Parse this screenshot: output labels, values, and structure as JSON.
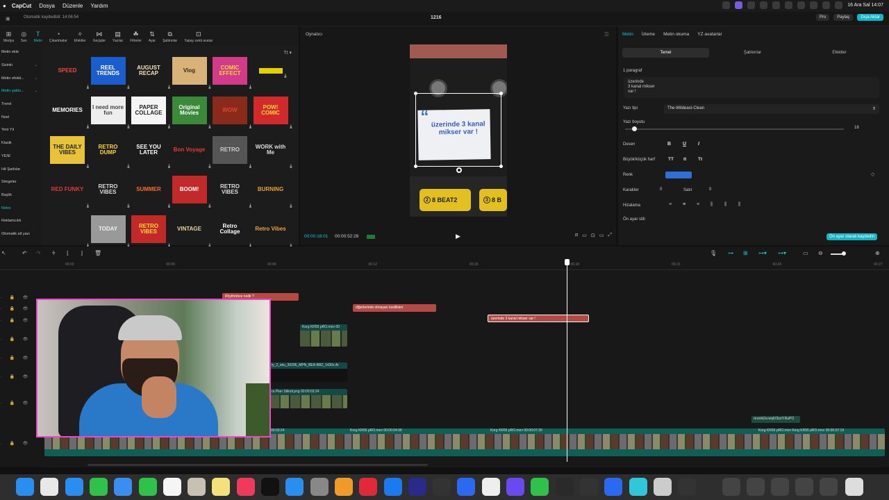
{
  "menubar": {
    "app": "CapCut",
    "items": [
      "Dosya",
      "Düzenle",
      "Yardım"
    ],
    "datetime": "16 Ara Sal  14:07"
  },
  "titlebar": {
    "autosave": "Otomatik kaydedildi: 14:06:54",
    "project": "1216",
    "pro": "Pro",
    "share": "Paylaş",
    "export": "Dışa Aktar"
  },
  "toolbar": [
    {
      "label": "Medya",
      "icon": "media-icon"
    },
    {
      "label": "Ses",
      "icon": "audio-icon"
    },
    {
      "label": "Metin",
      "icon": "text-icon",
      "active": true
    },
    {
      "label": "Çıkartmalar",
      "icon": "sticker-icon"
    },
    {
      "label": "Efektler",
      "icon": "effects-icon"
    },
    {
      "label": "Geçişler",
      "icon": "transitions-icon"
    },
    {
      "label": "Yazılar",
      "icon": "captions-icon"
    },
    {
      "label": "Filtreler",
      "icon": "filters-icon"
    },
    {
      "label": "Ayar",
      "icon": "adjust-icon"
    },
    {
      "label": "Şablonlar",
      "icon": "templates-icon"
    },
    {
      "label": "Yapay zekâ avatar",
      "icon": "ai-avatar-icon"
    }
  ],
  "categories": [
    {
      "label": "Metin ekle",
      "chev": false
    },
    {
      "label": "Sizinki",
      "chev": true
    },
    {
      "label": "Metin efekti...",
      "chev": true
    },
    {
      "label": "Metin şablo...",
      "chev": true,
      "selected": true
    },
    {
      "label": "Trend"
    },
    {
      "label": "Noel"
    },
    {
      "label": "Yeni Yıl"
    },
    {
      "label": "Klasik"
    },
    {
      "label": "YENİ"
    },
    {
      "label": "Hit Şarkılar"
    },
    {
      "label": "Simgeler"
    },
    {
      "label": "Başlık"
    },
    {
      "label": "Retro",
      "selected": true
    },
    {
      "label": "Reklamcılık"
    },
    {
      "label": "Otomatik alt yazı"
    }
  ],
  "templates": [
    {
      "text": "SPEED",
      "color": "#e94b3c",
      "bg": "transparent"
    },
    {
      "text": "REEL TRENDS",
      "color": "#fff",
      "bg": "#1b5ccf"
    },
    {
      "text": "AUGUST RECAP",
      "color": "#f2e3c2",
      "bg": "transparent"
    },
    {
      "text": "Vlog",
      "color": "#3a2a1a",
      "bg": "#d9b27a"
    },
    {
      "text": "COMIC EFFECT",
      "color": "#ffd53a",
      "bg": "#d23a8a"
    },
    {
      "text": "",
      "color": "#ffe000",
      "bg": "#e5d000"
    },
    {
      "text": "MEMORIES",
      "color": "#fff",
      "bg": "transparent"
    },
    {
      "text": "I need more fun",
      "color": "#444",
      "bg": "#eeeeee"
    },
    {
      "text": "PAPER COLLAGE",
      "color": "#222",
      "bg": "#f5f5f5"
    },
    {
      "text": "Original Movies",
      "color": "#fff",
      "bg": "#3a8a3a"
    },
    {
      "text": "WOW",
      "color": "#d84a2a",
      "bg": "#8a2a1a"
    },
    {
      "text": "POW! COMIC",
      "color": "#ffd53a",
      "bg": "#d22a2a"
    },
    {
      "text": "THE DAILY VIBES",
      "color": "#222",
      "bg": "#e8c33a"
    },
    {
      "text": "RETRO DUMP",
      "color": "#ffd53a",
      "bg": "transparent"
    },
    {
      "text": "SEE YOU LATER",
      "color": "#fff",
      "bg": "transparent"
    },
    {
      "text": "Bon Voyage",
      "color": "#e03a3a",
      "bg": "transparent"
    },
    {
      "text": "RETRO",
      "color": "#ccc",
      "bg": "#555"
    },
    {
      "text": "WORK with Me",
      "color": "#ddd",
      "bg": "transparent"
    },
    {
      "text": "RED FUNKY",
      "color": "#e03a3a",
      "bg": "transparent"
    },
    {
      "text": "RETRO VIBES",
      "color": "#ddd",
      "bg": "transparent"
    },
    {
      "text": "SUMMER",
      "color": "#ff6a2a",
      "bg": "transparent"
    },
    {
      "text": "BOOM!",
      "color": "#fff",
      "bg": "#c22a2a"
    },
    {
      "text": "RETRO VIBES",
      "color": "#ddd",
      "bg": "transparent"
    },
    {
      "text": "BURNING",
      "color": "#e8a22a",
      "bg": "transparent"
    },
    {
      "text": "",
      "color": "#222",
      "bg": "transparent"
    },
    {
      "text": "TODAY",
      "color": "#eee",
      "bg": "#999"
    },
    {
      "text": "RETRO VIBES",
      "color": "#ffd53a",
      "bg": "#c22a2a"
    },
    {
      "text": "VINTAGE",
      "color": "#e8d2a2",
      "bg": "transparent"
    },
    {
      "text": "Retro Collage",
      "color": "#fff",
      "bg": "transparent"
    },
    {
      "text": "Retro Vibes",
      "color": "#e8a24a",
      "bg": "transparent"
    }
  ],
  "player": {
    "title": "Oynatıcı",
    "caption": "üzerinde 3 kanal mikser var !",
    "beat1": "8 BEAT2",
    "beat1_num": "2",
    "beat2": "8 B",
    "beat2_num": "3",
    "current": "00:00:18:01",
    "total": "00:00:52:28"
  },
  "rpanel": {
    "tabs": [
      "Metin",
      "İzleme",
      "Metin okuma",
      "YZ avatarlar"
    ],
    "subtabs": [
      "Temel",
      "Şablonlar",
      "Efektler"
    ],
    "paragraph": "1 paragraf",
    "text_lines": [
      "üzerinde",
      "3 kanal mikser",
      "var !"
    ],
    "font_label": "Yazı tipi",
    "font": "The-Wildeast-Clean",
    "size_label": "Yazı boyutu",
    "size": "18",
    "size_fraction": 0.04,
    "pattern_label": "Desen",
    "case_label": "Büyük/küçük harf",
    "case": [
      "TT",
      "tt",
      "Tt"
    ],
    "color_label": "Renk",
    "color": "#2f6fd6",
    "char_label": "Karakter",
    "char": "0",
    "line_label": "Satır",
    "line": "0",
    "align_label": "Hizalama",
    "preset_label": "Ön ayar stili",
    "save_preset": "Ön ayar olarak kaydedin"
  },
  "timeline": {
    "ticks": [
      "00:03",
      "00:06",
      "00:09",
      "00:12",
      "00:15",
      "00:18",
      "00:21",
      "00:24",
      "00:27"
    ],
    "text_clips": [
      "Rhythmbox nedir ?",
      "diğerlerinde olmayan özellikleri",
      "üzerinde 3 kanal mikser var !"
    ],
    "v_clips": [
      "Korg KR55 pRO.mov  00",
      "ly_2_sku_39296_MPN_BEA-BB2_1430x Ar",
      "ra Pları Silindi.png  00:00:03:24"
    ],
    "main_labels": [
      "00:03:24",
      "Korg KR55 pRO.mov  00:00:04:06",
      "Korg KR55 pRO.mov  00:00:07:26",
      "Korg KR55 pRO.mov  Korg KR55 pRO.mov  00:00:07:19"
    ],
    "audio": "reverb2a-wqtV3ozY.RuPO"
  }
}
